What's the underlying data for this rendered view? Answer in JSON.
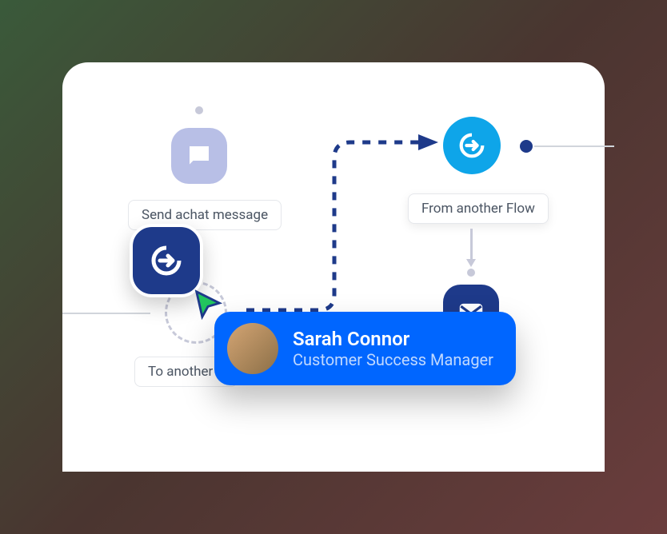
{
  "nodes": {
    "chat": {
      "label": "Send achat message"
    },
    "incoming": {
      "label": "From another Flow"
    },
    "target": {
      "label": "To another d"
    }
  },
  "user": {
    "name": "Sarah Connor",
    "role": "Customer Success Manager"
  }
}
